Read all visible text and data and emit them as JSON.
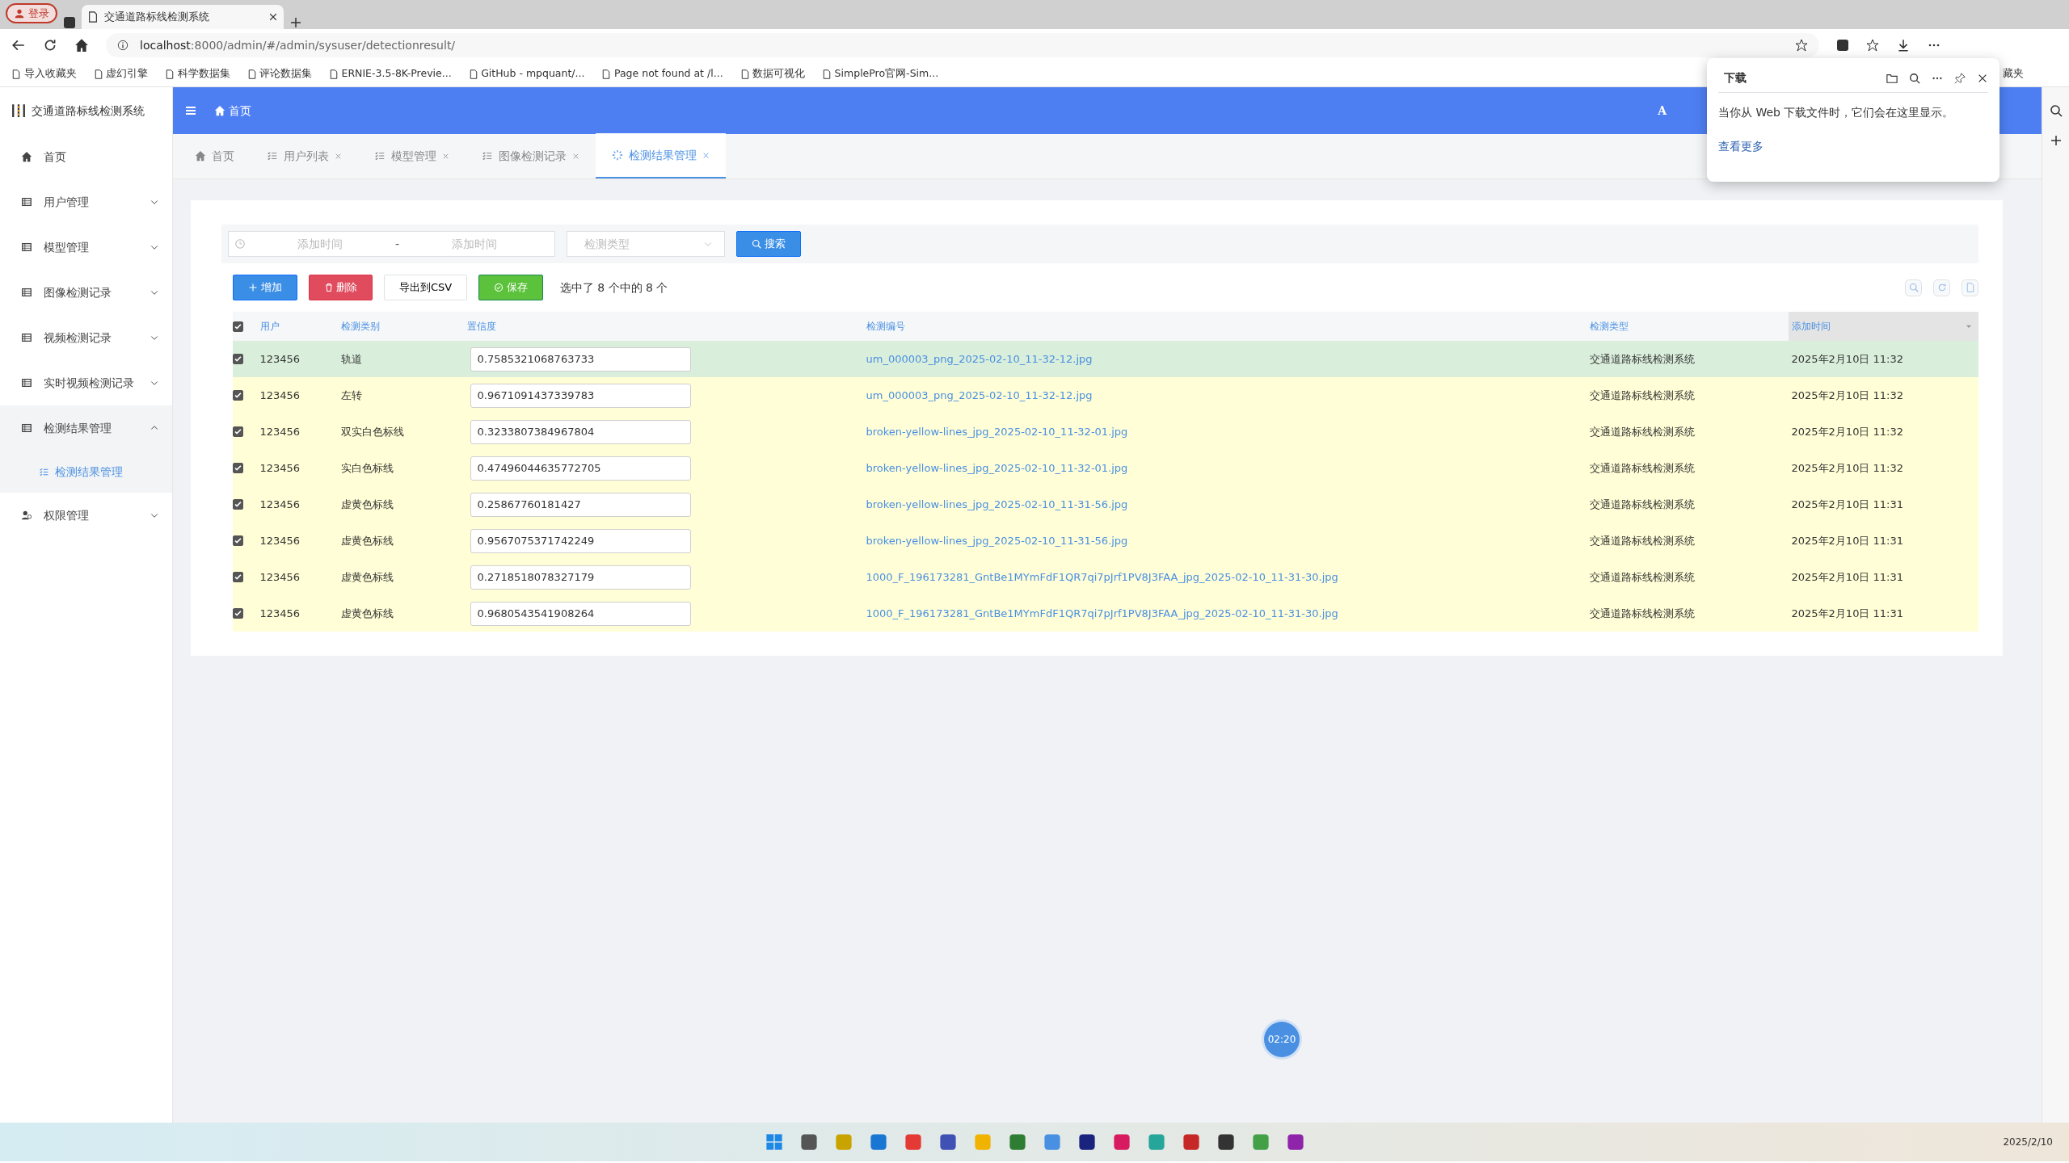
{
  "browser": {
    "login": "登录",
    "tabs": [
      {
        "title": "交通道路标线检测系统",
        "selected": true
      }
    ],
    "address_host": "localhost",
    "address_rest": ":8000/admin/#/admin/sysuser/detectionresult/",
    "bookmarks": [
      "导入收藏夹",
      "虚幻引擎",
      "科学数据集",
      "评论数据集",
      "ERNIE-3.5-8K-Previe...",
      "GitHub - mpquant/...",
      "Page not found at /l...",
      "数据可视化",
      "SimplePro官网-Sim..."
    ],
    "bookmark_cut": "藏夹"
  },
  "download_panel": {
    "title": "下载",
    "message": "当你从 Web 下载文件时，它们会在这里显示。",
    "link": "查看更多"
  },
  "app": {
    "brand": "交通道路标线检测系统",
    "breadcrumb": "首页",
    "user_initial": "A"
  },
  "sidebar": [
    {
      "label": "首页",
      "kind": "home",
      "expanded": false
    },
    {
      "label": "用户管理",
      "kind": "group",
      "expanded": false
    },
    {
      "label": "模型管理",
      "kind": "group",
      "expanded": false
    },
    {
      "label": "图像检测记录",
      "kind": "group",
      "expanded": false
    },
    {
      "label": "视频检测记录",
      "kind": "group",
      "expanded": false
    },
    {
      "label": "实时视频检测记录",
      "kind": "group",
      "expanded": false
    },
    {
      "label": "检测结果管理",
      "kind": "group",
      "expanded": true,
      "children": [
        {
          "label": "检测结果管理",
          "selected": true
        }
      ]
    },
    {
      "label": "权限管理",
      "kind": "people",
      "expanded": false
    }
  ],
  "tabs": [
    {
      "label": "首页",
      "kind": "home",
      "selected": false,
      "closable": false
    },
    {
      "label": "用户列表",
      "kind": "list",
      "selected": false,
      "closable": true
    },
    {
      "label": "模型管理",
      "kind": "list",
      "selected": false,
      "closable": true
    },
    {
      "label": "图像检测记录",
      "kind": "list",
      "selected": false,
      "closable": true
    },
    {
      "label": "检测结果管理",
      "kind": "spinner",
      "selected": true,
      "closable": true
    }
  ],
  "filters": {
    "start_placeholder": "添加时间",
    "separator": "-",
    "end_placeholder": "添加时间",
    "type_placeholder": "检测类型",
    "search": "搜索"
  },
  "toolbar": {
    "buttons": [
      {
        "label": "增加",
        "kind": "add"
      },
      {
        "label": "删除",
        "kind": "delete"
      },
      {
        "label": "导出到CSV",
        "kind": "plain"
      },
      {
        "label": "保存",
        "kind": "save"
      }
    ],
    "selection": "选中了 8 个中的 8 个"
  },
  "table": {
    "all_checked": true,
    "columns": [
      {
        "label": "用户",
        "sorted": false
      },
      {
        "label": "检测类别",
        "sorted": false
      },
      {
        "label": "置信度",
        "sorted": false
      },
      {
        "label": "检测编号",
        "sorted": false
      },
      {
        "label": "检测类型",
        "sorted": false
      },
      {
        "label": "添加时间",
        "sorted": true
      }
    ],
    "rows": [
      {
        "checked": true,
        "highlighted": true,
        "user": "123456",
        "category": "轨道",
        "confidence": "0.7585321068763733",
        "number": "um_000003_png_2025-02-10_11-32-12.jpg",
        "type": "交通道路标线检测系统",
        "time": "2025年2月10日 11:32"
      },
      {
        "checked": true,
        "highlighted": false,
        "user": "123456",
        "category": "左转",
        "confidence": "0.9671091437339783",
        "number": "um_000003_png_2025-02-10_11-32-12.jpg",
        "type": "交通道路标线检测系统",
        "time": "2025年2月10日 11:32"
      },
      {
        "checked": true,
        "highlighted": false,
        "user": "123456",
        "category": "双实白色标线",
        "confidence": "0.3233807384967804",
        "number": "broken-yellow-lines_jpg_2025-02-10_11-32-01.jpg",
        "type": "交通道路标线检测系统",
        "time": "2025年2月10日 11:32"
      },
      {
        "checked": true,
        "highlighted": false,
        "user": "123456",
        "category": "实白色标线",
        "confidence": "0.47496044635772705",
        "number": "broken-yellow-lines_jpg_2025-02-10_11-32-01.jpg",
        "type": "交通道路标线检测系统",
        "time": "2025年2月10日 11:32"
      },
      {
        "checked": true,
        "highlighted": false,
        "user": "123456",
        "category": "虚黄色标线",
        "confidence": "0.25867760181427",
        "number": "broken-yellow-lines_jpg_2025-02-10_11-31-56.jpg",
        "type": "交通道路标线检测系统",
        "time": "2025年2月10日 11:31"
      },
      {
        "checked": true,
        "highlighted": false,
        "user": "123456",
        "category": "虚黄色标线",
        "confidence": "0.9567075371742249",
        "number": "broken-yellow-lines_jpg_2025-02-10_11-31-56.jpg",
        "type": "交通道路标线检测系统",
        "time": "2025年2月10日 11:31"
      },
      {
        "checked": true,
        "highlighted": false,
        "user": "123456",
        "category": "虚黄色标线",
        "confidence": "0.2718518078327179",
        "number": "1000_F_196173281_GntBe1MYmFdF1QR7qi7pJrf1PV8J3FAA_jpg_2025-02-10_11-31-30.jpg",
        "type": "交通道路标线检测系统",
        "time": "2025年2月10日 11:31"
      },
      {
        "checked": true,
        "highlighted": false,
        "user": "123456",
        "category": "虚黄色标线",
        "confidence": "0.9680543541908264",
        "number": "1000_F_196173281_GntBe1MYmFdF1QR7qi7pJrf1PV8J3FAA_jpg_2025-02-10_11-31-30.jpg",
        "type": "交通道路标线检测系统",
        "time": "2025年2月10日 11:31"
      }
    ]
  },
  "timer": "02:20",
  "taskbar": {
    "date": "2025/2/10"
  }
}
